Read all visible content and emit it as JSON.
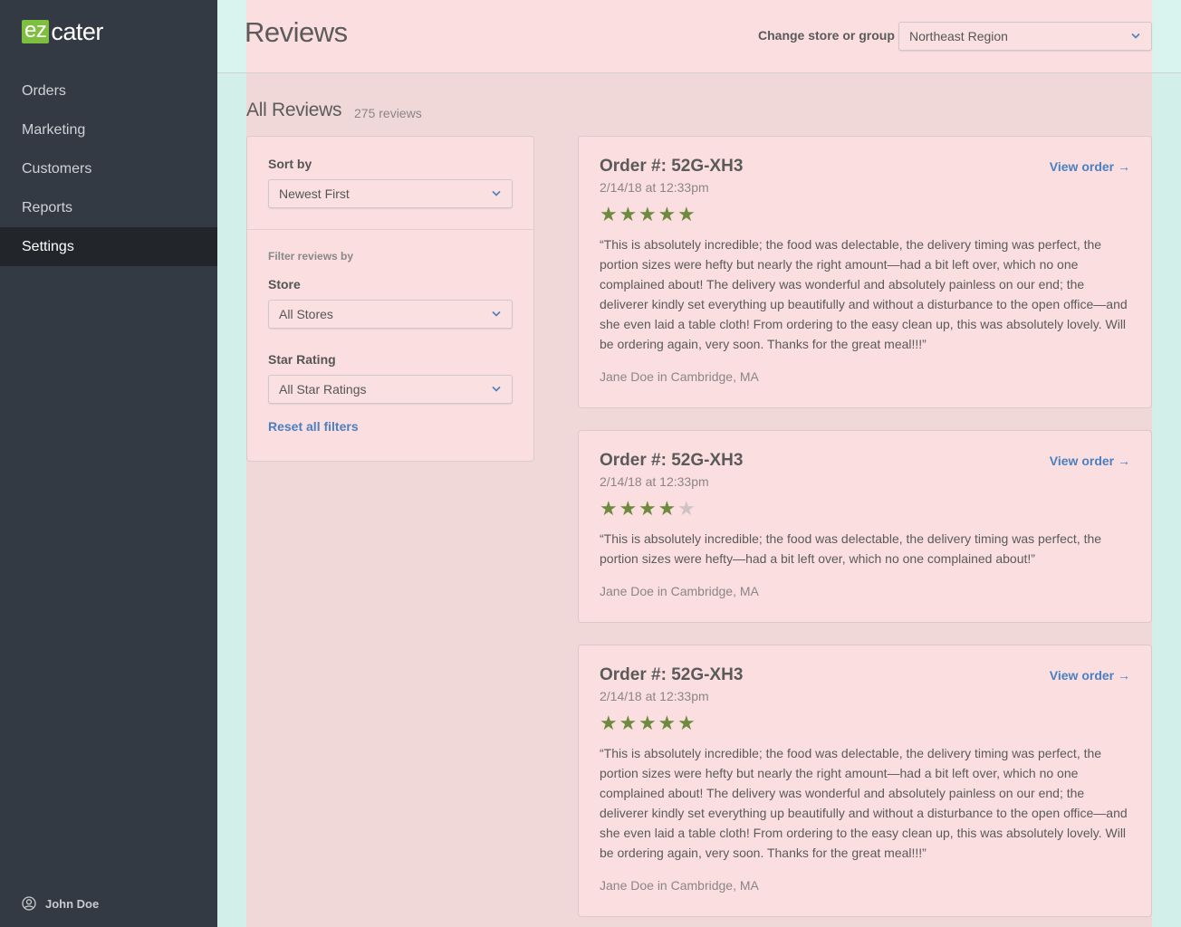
{
  "brand": {
    "logo_ez": "ez",
    "logo_cater": "cater",
    "accent": "#7fbf3f"
  },
  "sidebar": {
    "items": [
      {
        "label": "Orders"
      },
      {
        "label": "Marketing"
      },
      {
        "label": "Customers"
      },
      {
        "label": "Reports"
      },
      {
        "label": "Settings",
        "active": true
      }
    ],
    "user": "John Doe"
  },
  "header": {
    "title": "Reviews",
    "store_label": "Change store or group",
    "store_value": "Northeast Region"
  },
  "section": {
    "title": "All Reviews",
    "count": "275 reviews"
  },
  "filters": {
    "sort_label": "Sort by",
    "sort_value": "Newest First",
    "filter_heading": "Filter reviews by",
    "store_label": "Store",
    "store_value": "All Stores",
    "rating_label": "Star Rating",
    "rating_value": "All Star Ratings",
    "reset": "Reset all filters"
  },
  "reviews": [
    {
      "order": "Order #: 52G-XH3",
      "view": "View order →",
      "date": "2/14/18 at 12:33pm",
      "rating": 5,
      "text": "“This is absolutely incredible; the food was delectable, the delivery timing was perfect, the portion sizes were hefty but nearly the right amount—had a bit left over, which no one complained about! The delivery was wonderful and absolutely painless on our end; the deliverer kindly set everything up beautifully and without a disturbance to the open office—and she even laid a table cloth! From ordering to the easy clean up, this was absolutely lovely. Will be ordering again, very soon. Thanks for the great meal!!!”",
      "author": "Jane Doe in Cambridge, MA"
    },
    {
      "order": "Order #: 52G-XH3",
      "view": "View order →",
      "date": "2/14/18 at 12:33pm",
      "rating": 4,
      "text": "“This is absolutely incredible; the food was delectable, the delivery timing was perfect, the portion sizes were hefty—had a bit left over, which no one complained about!”",
      "author": "Jane Doe in Cambridge, MA"
    },
    {
      "order": "Order #: 52G-XH3",
      "view": "View order →",
      "date": "2/14/18 at 12:33pm",
      "rating": 5,
      "text": "“This is absolutely incredible; the food was delectable, the delivery timing was perfect, the portion sizes were hefty but nearly the right amount—had a bit left over, which no one complained about! The delivery was wonderful and absolutely painless on our end; the deliverer kindly set everything up beautifully and without a disturbance to the open office—and she even laid a table cloth! From ordering to the easy clean up, this was absolutely lovely. Will be ordering again, very soon. Thanks for the great meal!!!”",
      "author": "Jane Doe in Cambridge, MA"
    }
  ]
}
